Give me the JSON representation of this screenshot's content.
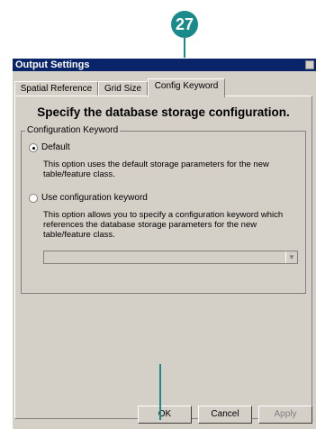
{
  "callout": {
    "number": "27",
    "color": "#1a8a8a"
  },
  "window": {
    "title": "Output Settings"
  },
  "tabs": [
    {
      "label": "Spatial Reference"
    },
    {
      "label": "Grid Size"
    },
    {
      "label": "Config Keyword",
      "active": true
    }
  ],
  "panel": {
    "heading": "Specify the database storage configuration.",
    "group_label": "Configuration Keyword",
    "options": [
      {
        "label": "Default",
        "selected": true,
        "description": [
          "This option uses the default storage parameters for the new",
          "table/feature class."
        ]
      },
      {
        "label": "Use configuration keyword",
        "selected": false,
        "description": [
          "This option allows you to specify a configuration keyword which",
          "references the database storage parameters for the new",
          "table/feature class."
        ]
      }
    ],
    "keyword_select": {
      "value": "",
      "enabled": false
    }
  },
  "buttons": {
    "ok": "OK",
    "cancel": "Cancel",
    "apply": "Apply"
  }
}
